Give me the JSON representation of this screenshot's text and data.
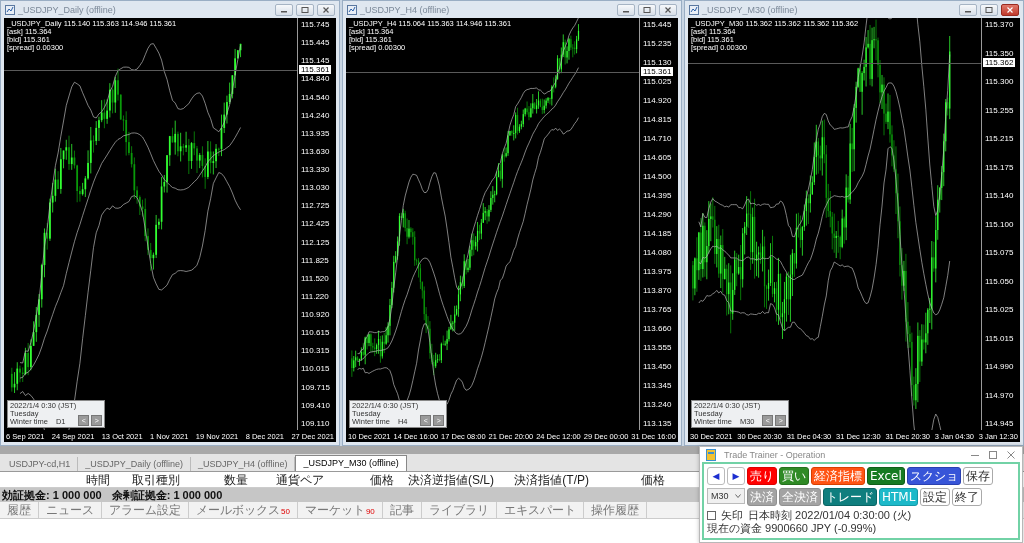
{
  "charts": [
    {
      "title": "_USDJPY_Daily (offline)",
      "active": false,
      "ohlc": "_USDJPY_Daily  115.140 115.363 114.946 115.361",
      "ask": "[ask] 115.364",
      "bid": "[bid] 115.361",
      "spread": "[spread] 0.00300",
      "price_tag": "115.361",
      "price_labels": [
        "115.745",
        "115.445",
        "115.145",
        "114.840",
        "114.540",
        "114.240",
        "113.935",
        "113.630",
        "113.330",
        "113.030",
        "112.725",
        "112.425",
        "112.125",
        "111.825",
        "111.520",
        "111.220",
        "110.920",
        "110.615",
        "110.315",
        "110.015",
        "109.715",
        "109.410",
        "109.110"
      ],
      "time_labels": [
        "6 Sep 2021",
        "24 Sep 2021",
        "13 Oct 2021",
        "1 Nov 2021",
        "19 Nov 2021",
        "8 Dec 2021",
        "27 Dec 2021"
      ],
      "nav": {
        "date": "2022/1/4 0:30 (JST)",
        "day": "Tuesday",
        "season": "Winter time",
        "period": "D1",
        "prev": "<",
        "next": ">"
      }
    },
    {
      "title": "_USDJPY_H4 (offline)",
      "active": false,
      "ohlc": "_USDJPY_H4  115.064 115.363 114.946 115.361",
      "ask": "[ask] 115.364",
      "bid": "[bid] 115.361",
      "spread": "[spread] 0.00300",
      "price_tag": "115.361",
      "price_labels": [
        "115.445",
        "115.235",
        "115.130",
        "115.025",
        "114.920",
        "114.815",
        "114.710",
        "114.605",
        "114.500",
        "114.395",
        "114.290",
        "114.185",
        "114.080",
        "113.975",
        "113.870",
        "113.765",
        "113.660",
        "113.555",
        "113.450",
        "113.345",
        "113.240",
        "113.135"
      ],
      "time_labels": [
        "10 Dec 2021",
        "14 Dec 16:00",
        "17 Dec 08:00",
        "21 Dec 20:00",
        "24 Dec 12:00",
        "29 Dec 00:00",
        "31 Dec 16:00"
      ],
      "nav": {
        "date": "2022/1/4 0:30 (JST)",
        "day": "Tuesday",
        "season": "Winter time",
        "period": "H4",
        "prev": "<",
        "next": ">"
      }
    },
    {
      "title": "_USDJPY_M30 (offline)",
      "active": true,
      "ohlc": "_USDJPY_M30  115.362 115.362 115.362 115.362",
      "ask": "[ask] 115.364",
      "bid": "[bid] 115.361",
      "spread": "[spread] 0.00300",
      "price_tag": "115.362",
      "price_labels": [
        "115.370",
        "115.350",
        "115.300",
        "115.255",
        "115.215",
        "115.175",
        "115.140",
        "115.100",
        "115.075",
        "115.050",
        "115.025",
        "115.015",
        "114.990",
        "114.970",
        "114.945"
      ],
      "time_labels": [
        "30 Dec 2021",
        "30 Dec 20:30",
        "31 Dec 04:30",
        "31 Dec 12:30",
        "31 Dec 20:30",
        "3 Jan 04:30",
        "3 Jan 12:30"
      ],
      "nav": {
        "date": "2022/1/4 0:30 (JST)",
        "day": "Tuesday",
        "season": "Winter time",
        "period": "M30",
        "prev": "<",
        "next": ">"
      }
    }
  ],
  "doc_tabs": [
    {
      "label": "USDJPY-cd,H1",
      "selected": false
    },
    {
      "label": "_USDJPY_Daily (offline)",
      "selected": false
    },
    {
      "label": "_USDJPY_H4 (offline)",
      "selected": false
    },
    {
      "label": "_USDJPY_M30 (offline)",
      "selected": true
    }
  ],
  "terminal": {
    "columns": [
      "時間",
      "取引種別",
      "数量",
      "通貨ペア",
      "価格",
      "決済逆指値(S/L)",
      "決済指値(T/P)",
      "価格"
    ],
    "equity": "効証拠金: 1 000 000",
    "free_margin": "余剰証拠金: 1 000 000"
  },
  "terminal_tabs": [
    {
      "label": "履歴",
      "selected": false
    },
    {
      "label": "ニュース",
      "selected": false
    },
    {
      "label": "アラーム設定",
      "selected": false
    },
    {
      "label": "メールボックス",
      "count": "50",
      "selected": false
    },
    {
      "label": "マーケット",
      "count": "90",
      "selected": false
    },
    {
      "label": "記事",
      "selected": false
    },
    {
      "label": "ライブラリ",
      "selected": false
    },
    {
      "label": "エキスパート",
      "selected": false
    },
    {
      "label": "操作履歴",
      "selected": false
    }
  ],
  "trade_trainer": {
    "title": "Trade Trainer - Operation",
    "buttons_row_1": [
      {
        "label": "◀",
        "kind": "arrow"
      },
      {
        "label": "▶",
        "kind": "arrow"
      },
      {
        "label": "売り",
        "kind": "red"
      },
      {
        "label": "買い",
        "kind": "green"
      },
      {
        "label": "経済指標",
        "kind": "orange"
      },
      {
        "label": "Excel",
        "kind": "darkgreen"
      },
      {
        "label": "スクショ",
        "kind": "blue"
      },
      {
        "label": "保存",
        "kind": "plain"
      }
    ],
    "timeframe": "M30",
    "buttons_row_2": [
      {
        "label": "決済",
        "kind": "grey"
      },
      {
        "label": "全決済",
        "kind": "grey"
      },
      {
        "label": "トレード",
        "kind": "teal"
      },
      {
        "label": "HTML",
        "kind": "cyan"
      },
      {
        "label": "設定",
        "kind": "plain"
      },
      {
        "label": "終了",
        "kind": "plain"
      }
    ],
    "arrow_checkbox": {
      "label": "矢印",
      "checked": false
    },
    "jst_time": "日本時刻 2022/01/04 0:30:00 (火)",
    "funds": "現在の資金 9900660 JPY (-0.99%)"
  }
}
